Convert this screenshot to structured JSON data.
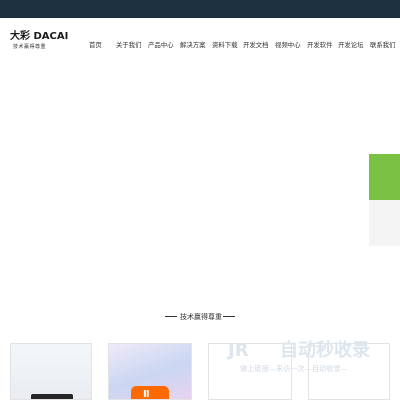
{
  "brand": {
    "logo_text": "大彩 DACAI",
    "tagline": "技术赢得尊重"
  },
  "nav": [
    {
      "label": "首页"
    },
    {
      "label": "关于我们"
    },
    {
      "label": "产品中心"
    },
    {
      "label": "解决方案"
    },
    {
      "label": "资料下载"
    },
    {
      "label": "开发文档"
    },
    {
      "label": "视频中心"
    },
    {
      "label": "开发软件"
    },
    {
      "label": "开发论坛"
    },
    {
      "label": "联系我们"
    }
  ],
  "section": {
    "title": "技术赢得尊重"
  },
  "watermark": {
    "main": "自动秒收录",
    "sub": "做上链接—来访一次—自动收录—"
  },
  "colors": {
    "topbar": "#1d3140",
    "accent_green": "#7bc143",
    "app_tile": "#ff6a00"
  },
  "icons": {
    "side_tab_primary": "green-tab",
    "watermark_logo": "jr-logo-icon"
  }
}
